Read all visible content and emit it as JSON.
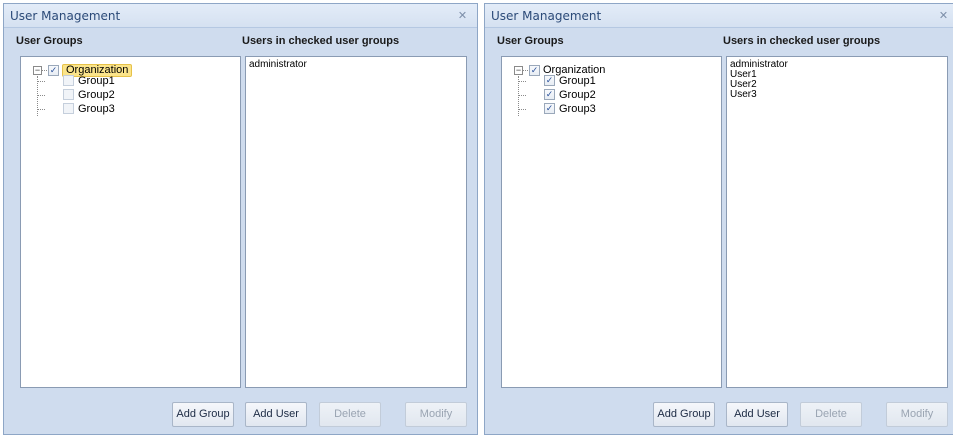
{
  "windows": [
    {
      "title": "User Management",
      "close_icon": "✕",
      "user_groups_label": "User Groups",
      "users_label": "Users in checked user groups",
      "tree": {
        "root": {
          "label": "Organization",
          "checked": true,
          "selected": true,
          "expander": "−"
        },
        "children": [
          {
            "label": "Group1",
            "checked": false
          },
          {
            "label": "Group2",
            "checked": false
          },
          {
            "label": "Group3",
            "checked": false
          }
        ]
      },
      "users": [
        "administrator"
      ],
      "buttons": {
        "add_group": "Add Group",
        "add_user": "Add User",
        "delete": "Delete",
        "modify": "Modify"
      }
    },
    {
      "title": "User Management",
      "close_icon": "✕",
      "user_groups_label": "User Groups",
      "users_label": "Users in checked user groups",
      "tree": {
        "root": {
          "label": "Organization",
          "checked": true,
          "selected": false,
          "expander": "−"
        },
        "children": [
          {
            "label": "Group1",
            "checked": true
          },
          {
            "label": "Group2",
            "checked": true
          },
          {
            "label": "Group3",
            "checked": true
          }
        ]
      },
      "users": [
        "administrator",
        "User1",
        "User2",
        "User3"
      ],
      "buttons": {
        "add_group": "Add Group",
        "add_user": "Add User",
        "delete": "Delete",
        "modify": "Modify"
      }
    }
  ],
  "check_mark": "✓",
  "icons": {
    "close": "close-icon",
    "expander": "collapse-icon",
    "checkbox": "checkbox-icon"
  }
}
